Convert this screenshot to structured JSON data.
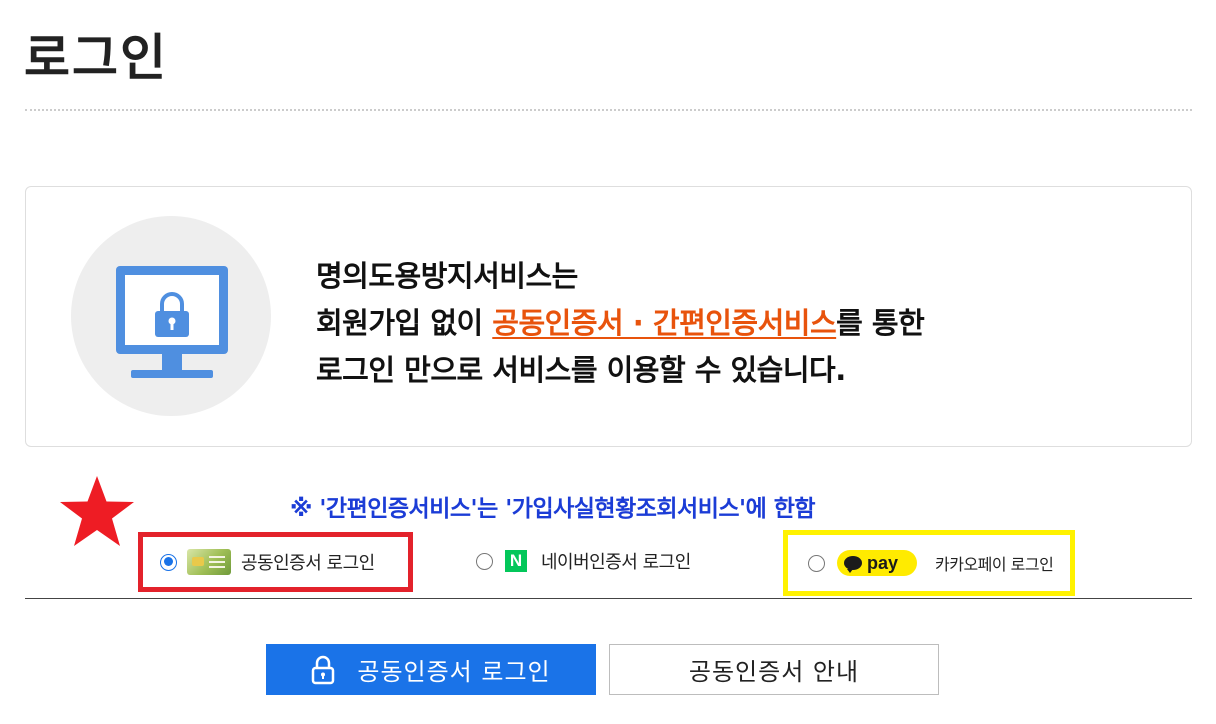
{
  "page": {
    "title": "로그인"
  },
  "info": {
    "line1": "명의도용방지서비스는",
    "line2_prefix": "회원가입 없이 ",
    "line2_highlight": "공동인증서 · 간편인증서비스",
    "line2_suffix": "를 통한",
    "line3": "로그인 만으로 서비스를 이용할 수 있습니다.",
    "highlight_color": "#e8530c"
  },
  "notice": {
    "text": "※ '간편인증서비스'는 '가입사실현황조회서비스'에 한함",
    "color": "#1b3cd6"
  },
  "login_methods": {
    "selected": "cert",
    "items": [
      {
        "id": "cert",
        "label": "공동인증서 로그인",
        "icon": "certificate-card-icon",
        "selected": true,
        "frame_color": "#e3222b"
      },
      {
        "id": "naver",
        "label": "네이버인증서 로그인",
        "icon": "naver-n-icon",
        "icon_text": "N",
        "selected": false
      },
      {
        "id": "kakao",
        "label": "카카오페이 로그인",
        "icon": "kakaopay-icon",
        "icon_text": "pay",
        "selected": false,
        "frame_color": "#fff200"
      }
    ]
  },
  "annotation": {
    "icon": "star-icon",
    "color": "#ee1c24"
  },
  "buttons": {
    "login_label": "공동인증서 로그인",
    "guide_label": "공동인증서 안내",
    "login_color": "#1a73e8"
  }
}
